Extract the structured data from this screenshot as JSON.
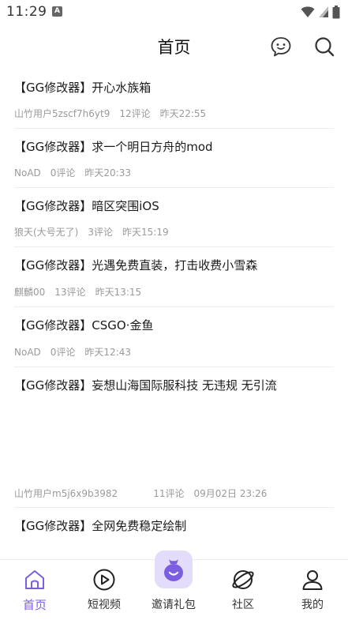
{
  "status": {
    "time": "11:29",
    "badge": "A"
  },
  "header": {
    "title": "首页"
  },
  "posts": [
    {
      "title": "【GG修改器】开心水族箱",
      "author": "山竹用户5zscf7h6yt9",
      "comments": "12评论",
      "time": "昨天22:55"
    },
    {
      "title": "【GG修改器】求一个明日方舟的mod",
      "author": "NoAD",
      "comments": "0评论",
      "time": "昨天20:33"
    },
    {
      "title": "【GG修改器】暗区突围iOS",
      "author": "狼天(大号无了)",
      "comments": "3评论",
      "time": "昨天15:19"
    },
    {
      "title": "【GG修改器】光遇免费直装，打击收费小雪森",
      "author": "麒麟00",
      "comments": "13评论",
      "time": "昨天13:15"
    },
    {
      "title": "【GG修改器】CSGO·金鱼",
      "author": "NoAD",
      "comments": "0评论",
      "time": "昨天12:43"
    },
    {
      "title": "【GG修改器】妄想山海国际服科技  无违规  无引流",
      "author": "山竹用户m5j6x9b3982",
      "comments": "11评论",
      "time": "09月02日 23:26"
    },
    {
      "title": "【GG修改器】全网免费稳定绘制",
      "author": "",
      "comments": "",
      "time": ""
    }
  ],
  "tabs": [
    {
      "label": "首页",
      "icon": "home-icon",
      "active": true
    },
    {
      "label": "短视频",
      "icon": "play-icon",
      "active": false
    },
    {
      "label": "邀请礼包",
      "icon": "gift-bag-icon",
      "active": false
    },
    {
      "label": "社区",
      "icon": "planet-icon",
      "active": false
    },
    {
      "label": "我的",
      "icon": "user-icon",
      "active": false
    }
  ],
  "colors": {
    "accent": "#7b5fe0",
    "invite_bg": "#e3dcfa",
    "meta_text": "#9a9a9a"
  }
}
